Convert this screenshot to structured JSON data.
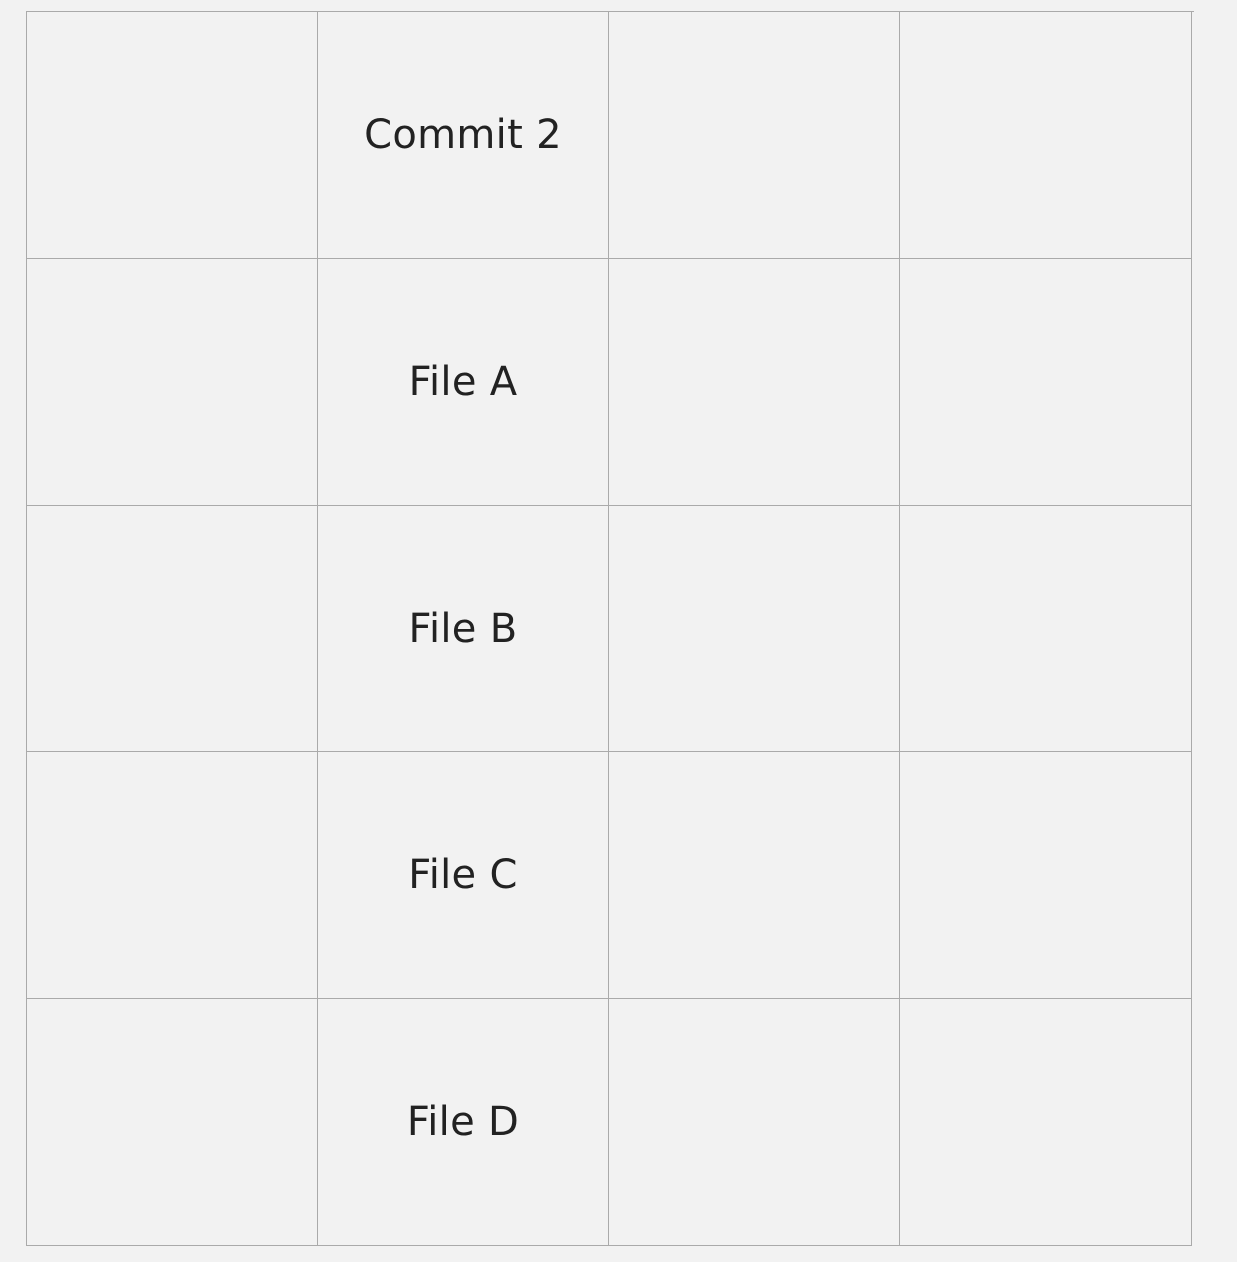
{
  "grid": {
    "rows": [
      [
        "",
        "Commit 2",
        "",
        ""
      ],
      [
        "",
        "File A",
        "",
        ""
      ],
      [
        "",
        "File B",
        "",
        ""
      ],
      [
        "",
        "File C",
        "",
        ""
      ],
      [
        "",
        "File D",
        "",
        ""
      ]
    ]
  },
  "colors": {
    "background": "#f2f2f2",
    "border": "#aaaaaa",
    "text": "#222222"
  }
}
